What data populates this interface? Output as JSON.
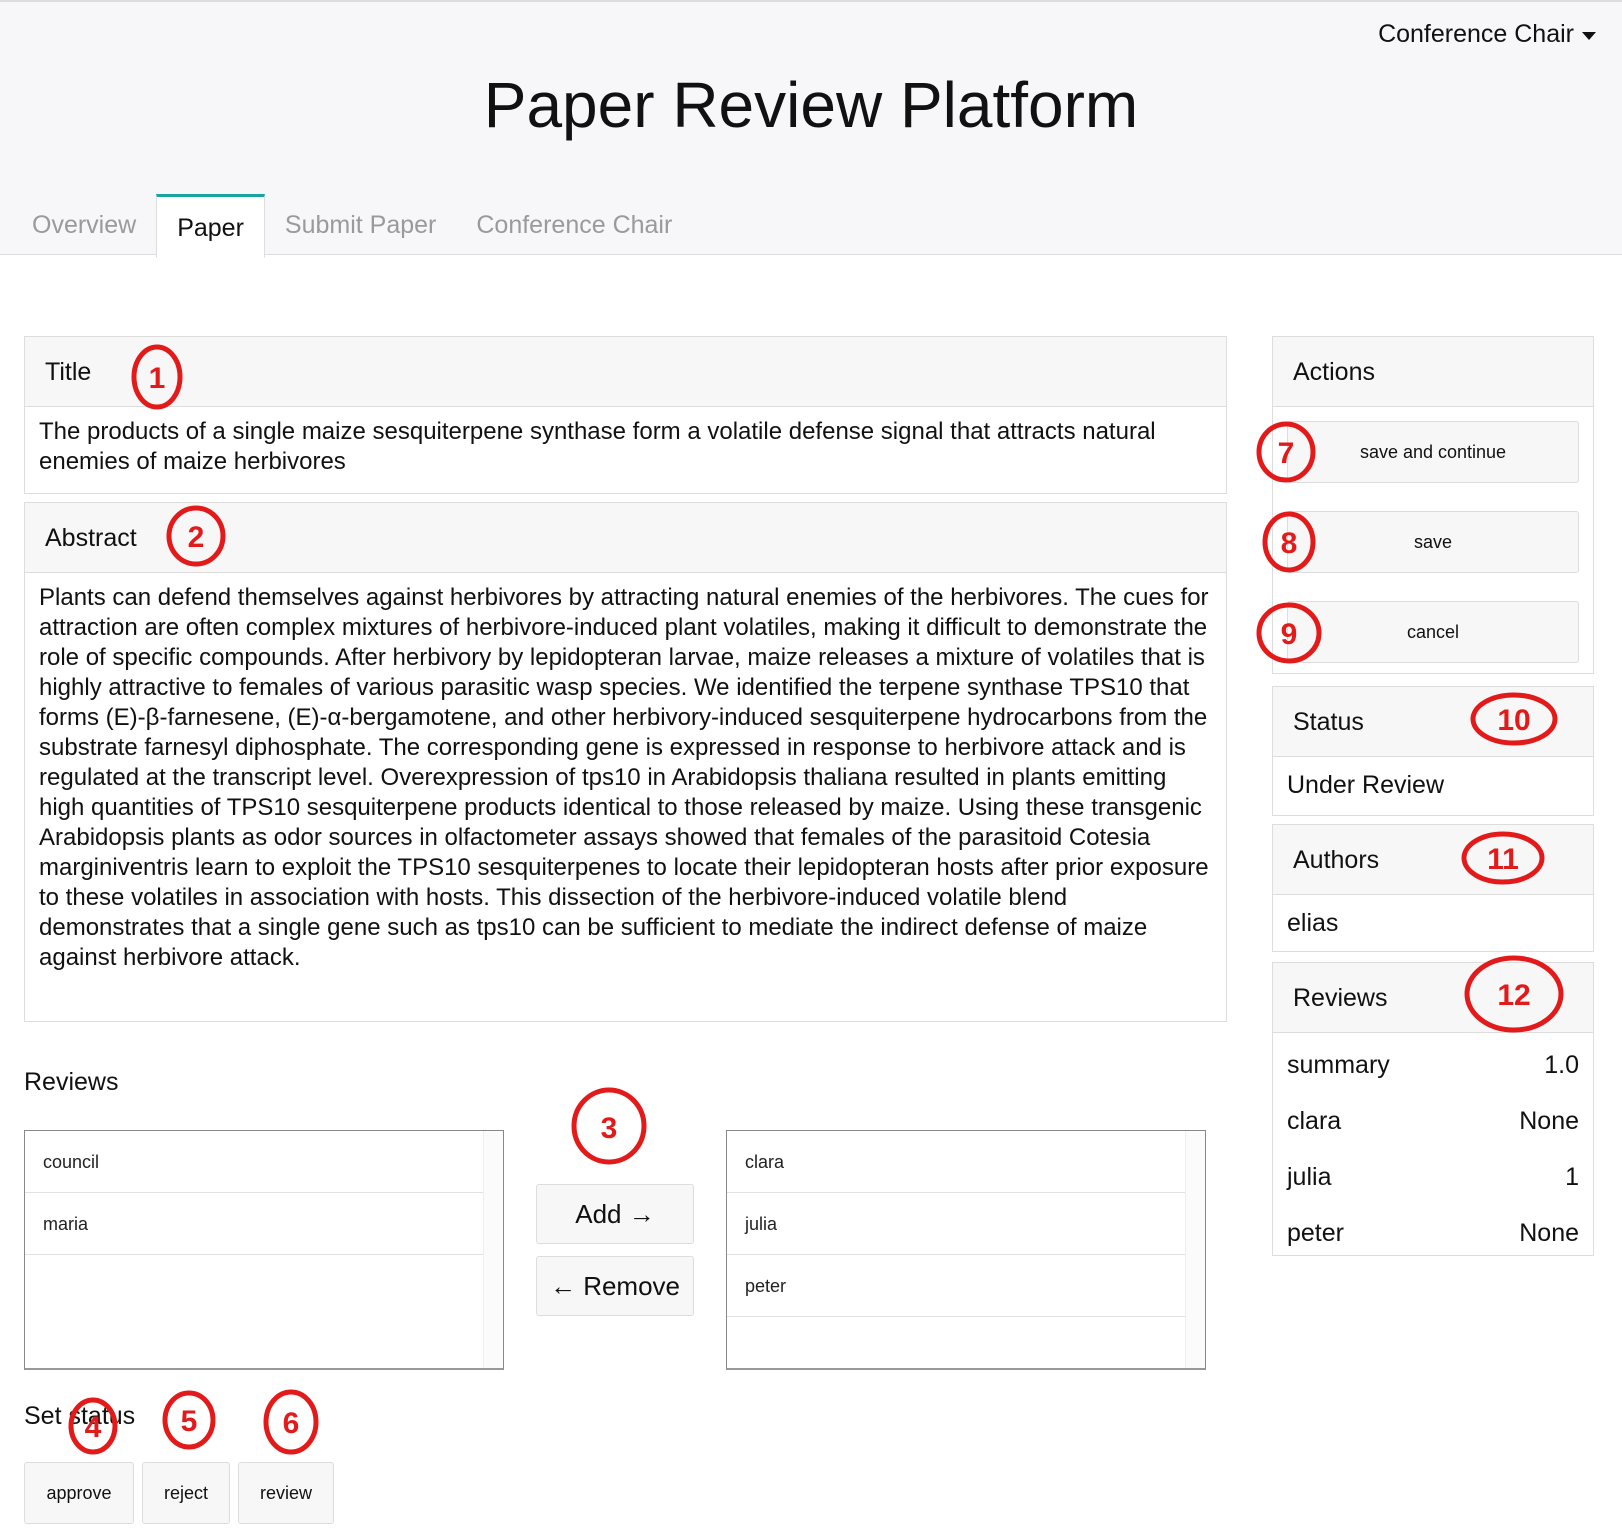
{
  "app": {
    "title": "Paper Review Platform",
    "user_menu": "Conference Chair"
  },
  "tabs": [
    {
      "label": "Overview",
      "active": false
    },
    {
      "label": "Paper",
      "active": true
    },
    {
      "label": "Submit Paper",
      "active": false
    },
    {
      "label": "Conference Chair",
      "active": false
    }
  ],
  "paper": {
    "title_heading": "Title",
    "title_text": "The products of a single maize sesquiterpene synthase form a volatile defense signal that attracts natural enemies of maize herbivores",
    "abstract_heading": "Abstract",
    "abstract_text": "Plants can defend themselves against herbivores by attracting natural enemies of the herbivores. The cues for attraction are often complex mixtures of herbivore-induced plant volatiles, making it difficult to demonstrate the role of specific compounds. After herbivory by lepidopteran larvae, maize releases a mixture of volatiles that is highly attractive to females of various parasitic wasp species. We identified the terpene synthase TPS10 that forms (E)-β-farnesene, (E)-α-bergamotene, and other herbivory-induced sesquiterpene hydrocarbons from the substrate farnesyl diphosphate. The corresponding gene is expressed in response to herbivore attack and is regulated at the transcript level. Overexpression of tps10 in Arabidopsis thaliana resulted in plants emitting high quantities of TPS10 sesquiterpene products identical to those released by maize. Using these transgenic Arabidopsis plants as odor sources in olfactometer assays showed that females of the parasitoid Cotesia marginiventris learn to exploit the TPS10 sesquiterpenes to locate their lepidopteran hosts after prior exposure to these volatiles in association with hosts. This dissection of the herbivore-induced volatile blend demonstrates that a single gene such as tps10 can be sufficient to mediate the indirect defense of maize against herbivore attack."
  },
  "reviewer_assignment": {
    "heading": "Reviews",
    "available": [
      "council",
      "maria"
    ],
    "assigned": [
      "clara",
      "julia",
      "peter"
    ],
    "add_label": "Add →",
    "remove_label": "← Remove"
  },
  "set_status": {
    "heading": "Set status",
    "approve": "approve",
    "reject": "reject",
    "review": "review"
  },
  "actions": {
    "heading": "Actions",
    "save_continue": "save and continue",
    "save": "save",
    "cancel": "cancel"
  },
  "status": {
    "heading": "Status",
    "value": "Under Review"
  },
  "authors": {
    "heading": "Authors",
    "names": [
      "elias"
    ]
  },
  "reviews": {
    "heading": "Reviews",
    "rows": [
      {
        "name": "summary",
        "score": "1.0"
      },
      {
        "name": "clara",
        "score": "None"
      },
      {
        "name": "julia",
        "score": "1"
      },
      {
        "name": "peter",
        "score": "None"
      }
    ]
  },
  "annotations": [
    "1",
    "2",
    "3",
    "4",
    "5",
    "6",
    "7",
    "8",
    "9",
    "10",
    "11",
    "12"
  ],
  "colors": {
    "accent_tab": "#1aa3a3",
    "annotation": "#e31a1a"
  }
}
